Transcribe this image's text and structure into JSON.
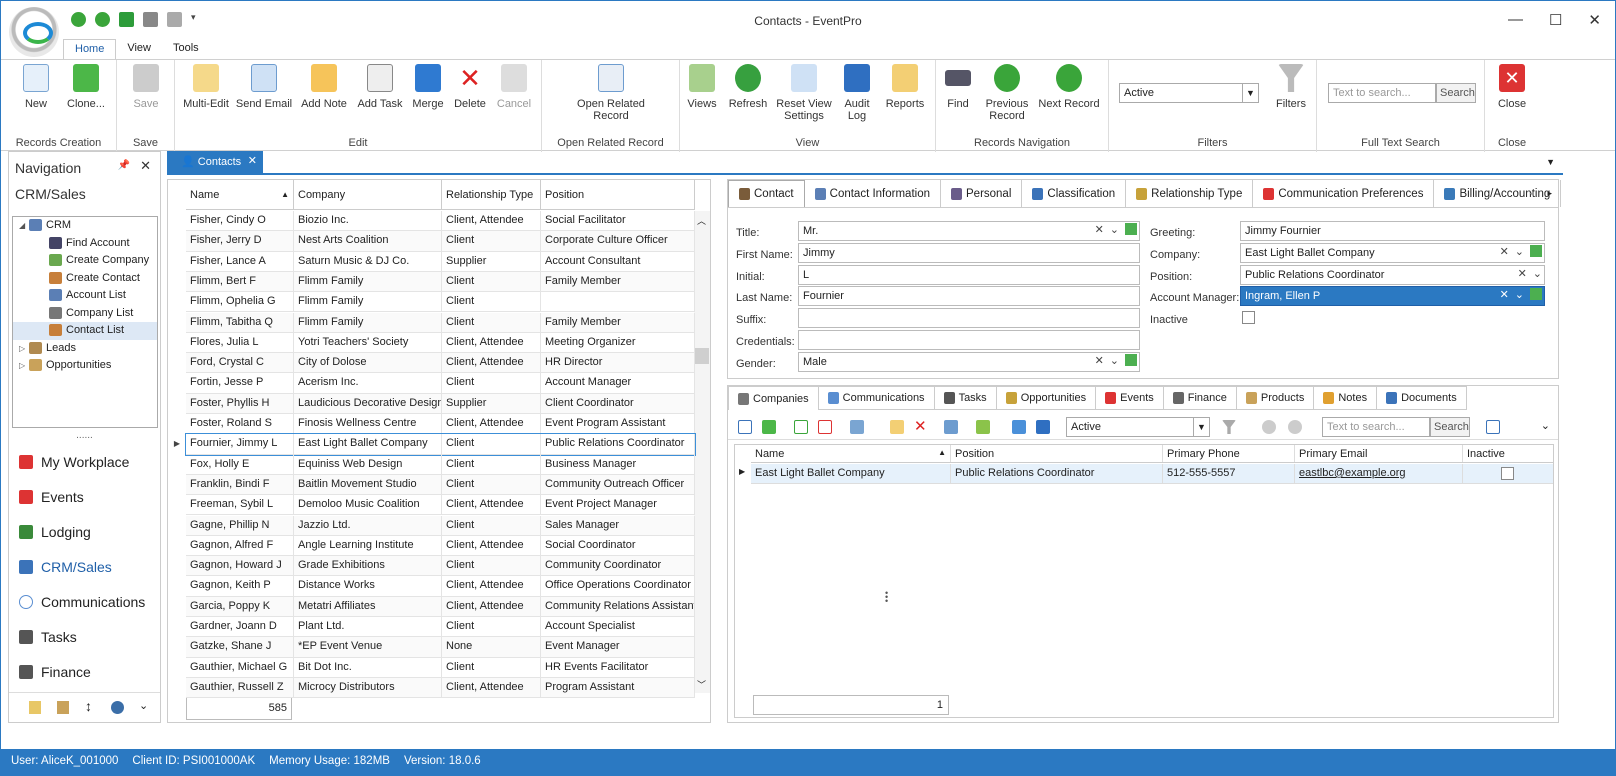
{
  "window": {
    "title": "Contacts - EventPro",
    "min": "—",
    "max": "☐",
    "close": "✕"
  },
  "menu": {
    "tabs": [
      "Home",
      "View",
      "Tools"
    ]
  },
  "ribbon": {
    "records_creation": {
      "label": "Records Creation",
      "new": "New",
      "clone": "Clone..."
    },
    "save": {
      "label": "Save",
      "save": "Save"
    },
    "edit": {
      "label": "Edit",
      "multi_edit": "Multi-Edit",
      "send_email": "Send Email",
      "add_note": "Add Note",
      "add_task": "Add Task",
      "merge": "Merge",
      "delete": "Delete",
      "cancel": "Cancel"
    },
    "open_related": {
      "label": "Open Related Record",
      "button": "Open Related Record"
    },
    "view": {
      "label": "View",
      "views": "Views",
      "refresh": "Refresh",
      "reset": "Reset View Settings",
      "audit": "Audit Log",
      "reports": "Reports"
    },
    "records_navigation": {
      "label": "Records Navigation",
      "find": "Find",
      "previous": "Previous Record",
      "next": "Next Record"
    },
    "filters": {
      "label": "Filters",
      "value": "Active",
      "filters": "Filters"
    },
    "full_text": {
      "label": "Full Text Search",
      "placeholder": "Text to search...",
      "search": "Search"
    },
    "close": {
      "label": "Close",
      "close": "Close"
    }
  },
  "nav": {
    "title": "Navigation",
    "section": "CRM/Sales",
    "tree": [
      {
        "label": "CRM",
        "level": 0,
        "exp": "◢"
      },
      {
        "label": "Find Account",
        "level": 1
      },
      {
        "label": "Create Company",
        "level": 1
      },
      {
        "label": "Create Contact",
        "level": 1
      },
      {
        "label": "Account List",
        "level": 1
      },
      {
        "label": "Company List",
        "level": 1
      },
      {
        "label": "Contact List",
        "level": 1
      },
      {
        "label": "Leads",
        "level": 0,
        "exp": "▷"
      },
      {
        "label": "Opportunities",
        "level": 0,
        "exp": "▷"
      }
    ],
    "grip": "......",
    "modules": [
      "My Workplace",
      "Events",
      "Lodging",
      "CRM/Sales",
      "Communications",
      "Tasks",
      "Finance"
    ]
  },
  "doc_tab": {
    "label": "Contacts"
  },
  "grid": {
    "headers": [
      "Name",
      "Company",
      "Relationship Type",
      "Position"
    ],
    "rows": [
      [
        "Fisher, Cindy O",
        "Biozio Inc.",
        "Client, Attendee",
        "Social Facilitator"
      ],
      [
        "Fisher, Jerry D",
        "Nest Arts Coalition",
        "Client",
        "Corporate Culture Officer"
      ],
      [
        "Fisher, Lance A",
        "Saturn Music & DJ Co.",
        "Supplier",
        "Account Consultant"
      ],
      [
        "Flimm, Bert F",
        "Flimm Family",
        "Client",
        "Family Member"
      ],
      [
        "Flimm, Ophelia G",
        "Flimm Family",
        "Client",
        ""
      ],
      [
        "Flimm, Tabitha Q",
        "Flimm Family",
        "Client",
        "Family Member"
      ],
      [
        "Flores, Julia L",
        "Yotri Teachers' Society",
        "Client, Attendee",
        "Meeting Organizer"
      ],
      [
        "Ford, Crystal C",
        "City of Dolose",
        "Client, Attendee",
        "HR Director"
      ],
      [
        "Fortin, Jesse P",
        "Acerism Inc.",
        "Client",
        "Account Manager"
      ],
      [
        "Foster, Phyllis H",
        "Laudicious Decorative Design",
        "Supplier",
        "Client Coordinator"
      ],
      [
        "Foster, Roland S",
        "Finosis Wellness Centre",
        "Client, Attendee",
        "Event Program Assistant"
      ],
      [
        "Fournier, Jimmy L",
        "East Light Ballet Company",
        "Client",
        "Public Relations Coordinator"
      ],
      [
        "Fox, Holly E",
        "Equiniss Web Design",
        "Client",
        "Business Manager"
      ],
      [
        "Franklin, Bindi F",
        "Baitlin Movement Studio",
        "Client",
        "Community Outreach Officer"
      ],
      [
        "Freeman, Sybil L",
        "Demoloo Music Coalition",
        "Client, Attendee",
        "Event Project Manager"
      ],
      [
        "Gagne, Phillip N",
        "Jazzio Ltd.",
        "Client",
        "Sales Manager"
      ],
      [
        "Gagnon, Alfred F",
        "Angle Learning Institute",
        "Client, Attendee",
        "Social Coordinator"
      ],
      [
        "Gagnon, Howard J",
        "Grade Exhibitions",
        "Client",
        "Community Coordinator"
      ],
      [
        "Gagnon, Keith P",
        "Distance Works",
        "Client, Attendee",
        "Office Operations Coordinator"
      ],
      [
        "Garcia, Poppy K",
        "Metatri Affiliates",
        "Client, Attendee",
        "Community Relations Assistant"
      ],
      [
        "Gardner, Joann D",
        "Plant Ltd.",
        "Client",
        "Account Specialist"
      ],
      [
        "Gatzke, Shane J",
        "*EP Event Venue",
        "None",
        "Event Manager"
      ],
      [
        "Gauthier, Michael G",
        "Bit Dot Inc.",
        "Client",
        "HR Events Facilitator"
      ],
      [
        "Gauthier, Russell Z",
        "Microcy Distributors",
        "Client, Attendee",
        "Program Assistant"
      ]
    ],
    "count": "585"
  },
  "detail": {
    "tabs": [
      "Contact",
      "Contact Information",
      "Personal",
      "Classification",
      "Relationship Type",
      "Communication Preferences",
      "Billing/Accounting"
    ],
    "labels": {
      "title": "Title:",
      "first": "First Name:",
      "initial": "Initial:",
      "last": "Last Name:",
      "suffix": "Suffix:",
      "credentials": "Credentials:",
      "gender": "Gender:",
      "greeting": "Greeting:",
      "company": "Company:",
      "position": "Position:",
      "manager": "Account Manager:",
      "inactive": "Inactive"
    },
    "values": {
      "title": "Mr.",
      "first": "Jimmy",
      "initial": "L",
      "last": "Fournier",
      "suffix": "",
      "credentials": "",
      "gender": "Male",
      "greeting": "Jimmy Fournier",
      "company": "East Light Ballet Company",
      "position": "Public Relations Coordinator",
      "manager": "Ingram, Ellen P"
    }
  },
  "sub": {
    "tabs": [
      "Companies",
      "Communications",
      "Tasks",
      "Opportunities",
      "Events",
      "Finance",
      "Products",
      "Notes",
      "Documents"
    ],
    "filter": "Active",
    "placeholder": "Text to search...",
    "search": "Search",
    "headers": [
      "Name",
      "Position",
      "Primary Phone",
      "Primary Email",
      "Inactive"
    ],
    "row": [
      "East Light Ballet Company",
      "Public Relations Coordinator",
      "512-555-5557",
      "eastlbc@example.org"
    ],
    "count": "1"
  },
  "status": {
    "user": "User: AliceK_001000",
    "client": "Client ID: PSI001000AK",
    "memory": "Memory Usage: 182MB",
    "version": "Version: 18.0.6"
  }
}
